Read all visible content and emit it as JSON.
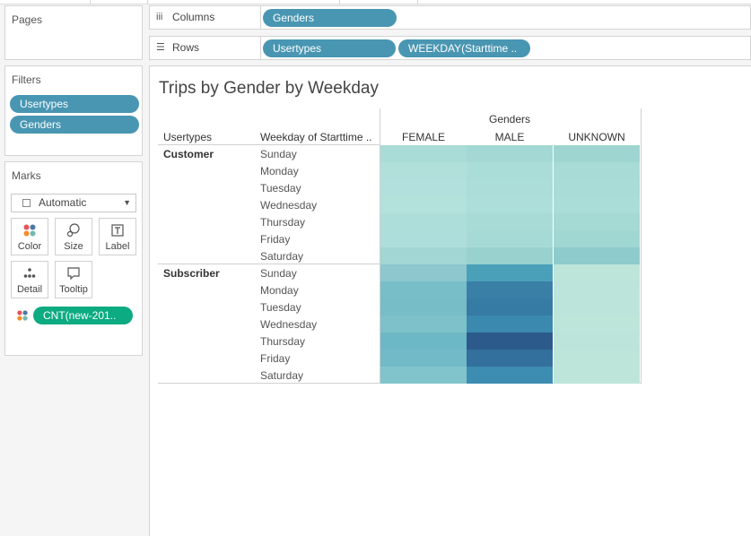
{
  "pages": {
    "title": "Pages"
  },
  "columns_shelf": {
    "label": "Columns",
    "pills": [
      "Genders"
    ]
  },
  "rows_shelf": {
    "label": "Rows",
    "pills": [
      "Usertypes",
      "WEEKDAY(Starttime .."
    ]
  },
  "filters": {
    "title": "Filters",
    "items": [
      "Usertypes",
      "Genders"
    ]
  },
  "marks": {
    "title": "Marks",
    "type": "Automatic",
    "buttons": [
      "Color",
      "Size",
      "Label",
      "Detail",
      "Tooltip"
    ],
    "color_field": "CNT(new-201.."
  },
  "view": {
    "title": "Trips by Gender by Weekday",
    "col_group_header": "Genders",
    "row_headers": [
      "Usertypes",
      "Weekday of Starttime .."
    ],
    "columns": [
      "FEMALE",
      "MALE",
      "UNKNOWN"
    ],
    "groups": [
      {
        "name": "Customer",
        "days": [
          "Sunday",
          "Monday",
          "Tuesday",
          "Wednesday",
          "Thursday",
          "Friday",
          "Saturday"
        ],
        "colors": [
          [
            "#a9dbd7",
            "#a3d8d4",
            "#9ed5d1"
          ],
          [
            "#b1e0db",
            "#abddd8",
            "#a8dbd6"
          ],
          [
            "#b2e0dc",
            "#acddd9",
            "#a9dbd7"
          ],
          [
            "#b3e1dc",
            "#aededa",
            "#abddd8"
          ],
          [
            "#aededa",
            "#a8dbd6",
            "#a4d9d4"
          ],
          [
            "#addedb",
            "#a6dad6",
            "#a1d7d3"
          ],
          [
            "#a2d6d4",
            "#99d1cf",
            "#8ecbcc"
          ]
        ]
      },
      {
        "name": "Subscriber",
        "days": [
          "Sunday",
          "Monday",
          "Tuesday",
          "Wednesday",
          "Thursday",
          "Friday",
          "Saturday"
        ],
        "colors": [
          [
            "#8ec7cd",
            "#4aa0b9",
            "#bde5da"
          ],
          [
            "#77bec8",
            "#3a7fa6",
            "#bce4da"
          ],
          [
            "#76bdc8",
            "#367ba4",
            "#bce4da"
          ],
          [
            "#7ec1ca",
            "#3b89ae",
            "#bde5da"
          ],
          [
            "#6db8c6",
            "#2c5a8a",
            "#bce4da"
          ],
          [
            "#72bac7",
            "#33709d",
            "#bde5da"
          ],
          [
            "#82c4cc",
            "#3d8db2",
            "#bde5da"
          ]
        ]
      }
    ]
  }
}
